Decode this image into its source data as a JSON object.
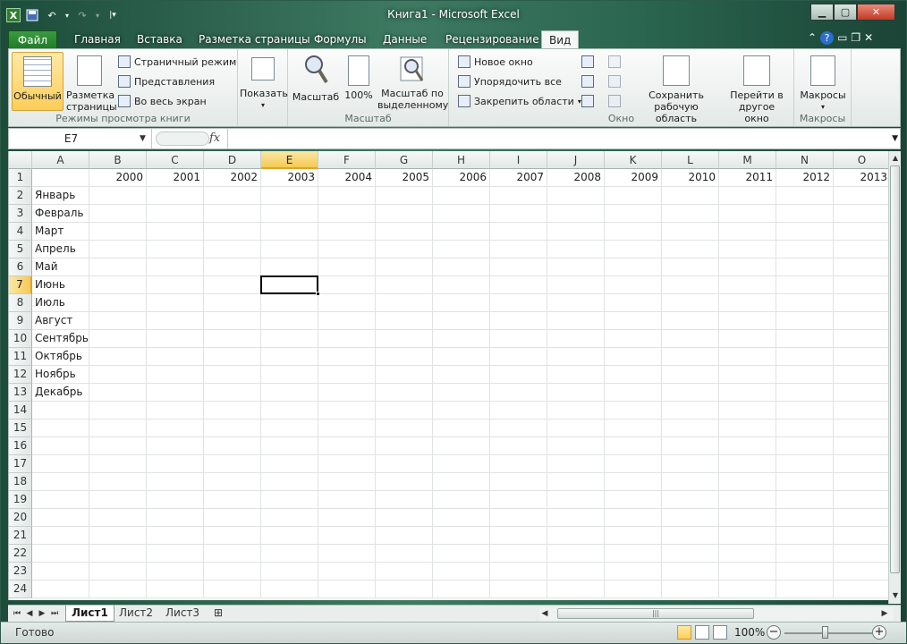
{
  "window": {
    "title": "Книга1  -  Microsoft Excel"
  },
  "ribbon_tabs": [
    "Файл",
    "Главная",
    "Вставка",
    "Разметка страницы",
    "Формулы",
    "Данные",
    "Рецензирование",
    "Вид"
  ],
  "active_tab": "Вид",
  "ribbon": {
    "views": {
      "label": "Режимы просмотра книги",
      "normal": "Обычный",
      "page_layout": "Разметка страницы",
      "page_break": "Страничный режим",
      "custom_views": "Представления",
      "full_screen": "Во весь экран"
    },
    "show": {
      "label": "Показать"
    },
    "zoom": {
      "label": "Масштаб",
      "zoom": "Масштаб",
      "zoom100": "100%",
      "zoom_sel": "Масштаб по выделенному"
    },
    "window": {
      "label": "Окно",
      "new_window": "Новое окно",
      "arrange_all": "Упорядочить все",
      "freeze": "Закрепить области",
      "save_workspace": "Сохранить рабочую область",
      "switch_windows": "Перейти в другое окно"
    },
    "macros": {
      "label": "Макросы",
      "macros": "Макросы"
    }
  },
  "formula_bar": {
    "name_box": "E7",
    "fx": "fx",
    "content": ""
  },
  "columns": [
    "A",
    "B",
    "C",
    "D",
    "E",
    "F",
    "G",
    "H",
    "I",
    "J",
    "K",
    "L",
    "M",
    "N",
    "O"
  ],
  "selected_column": "E",
  "selected_row": 7,
  "row_numbers": [
    1,
    2,
    3,
    4,
    5,
    6,
    7,
    8,
    9,
    10,
    11,
    12,
    13,
    14,
    15,
    16,
    17,
    18,
    19,
    20,
    21,
    22,
    23,
    24
  ],
  "years": [
    "2000",
    "2001",
    "2002",
    "2003",
    "2004",
    "2005",
    "2006",
    "2007",
    "2008",
    "2009",
    "2010",
    "2011",
    "2012",
    "2013"
  ],
  "months": [
    "Январь",
    "Февраль",
    "Март",
    "Апрель",
    "Май",
    "Июнь",
    "Июль",
    "Август",
    "Сентябрь",
    "Октябрь",
    "Ноябрь",
    "Декабрь"
  ],
  "sheets": [
    "Лист1",
    "Лист2",
    "Лист3"
  ],
  "active_sheet": "Лист1",
  "status": {
    "text": "Готово",
    "zoom": "100%"
  }
}
